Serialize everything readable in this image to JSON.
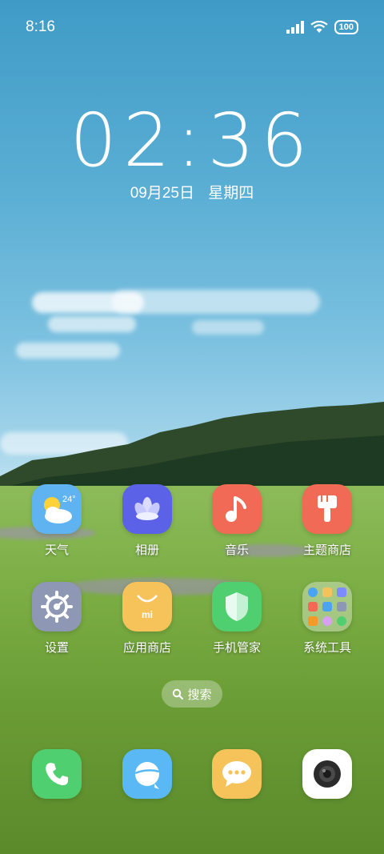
{
  "status_bar": {
    "time": "8:16",
    "battery": "100"
  },
  "lock_clock": {
    "time": "02:36",
    "date": "09月25日",
    "weekday": "星期四"
  },
  "apps": [
    {
      "label": "天气",
      "icon": "weather-icon",
      "color": "#5fb3f0",
      "temp": "24°"
    },
    {
      "label": "相册",
      "icon": "gallery-icon",
      "color": "#5b62e8"
    },
    {
      "label": "音乐",
      "icon": "music-icon",
      "color": "#f06a55"
    },
    {
      "label": "主题商店",
      "icon": "theme-store-icon",
      "color": "#f06a55"
    },
    {
      "label": "设置",
      "icon": "settings-icon",
      "color": "#8e97b3"
    },
    {
      "label": "应用商店",
      "icon": "app-store-icon",
      "color": "#f6c35a"
    },
    {
      "label": "手机管家",
      "icon": "security-icon",
      "color": "#4fcf70"
    },
    {
      "label": "系统工具",
      "icon": "folder-icon",
      "color": "rgba(255,255,255,0.35)"
    }
  ],
  "search": {
    "label": "搜索"
  },
  "dock": [
    {
      "name": "phone",
      "icon": "phone-icon",
      "color": "#4fcf70"
    },
    {
      "name": "browser",
      "icon": "browser-icon",
      "color": "#5ab8f5"
    },
    {
      "name": "messages",
      "icon": "messages-icon",
      "color": "#f6c35a"
    },
    {
      "name": "camera",
      "icon": "camera-icon",
      "color": "#ffffff"
    }
  ]
}
